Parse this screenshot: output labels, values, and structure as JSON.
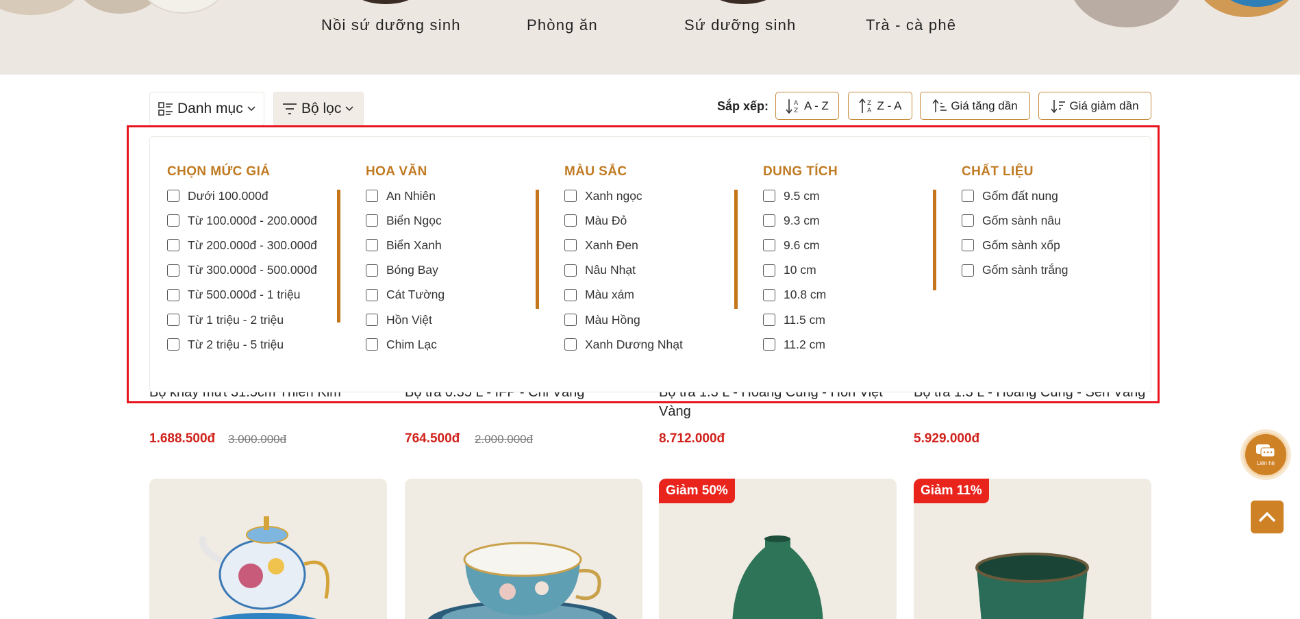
{
  "hero": {
    "categories": [
      "Nồi sứ dưỡng sinh",
      "Phòng ăn",
      "Sứ dưỡng sinh",
      "Trà - cà phê"
    ]
  },
  "toolbar": {
    "category_label": "Danh mục",
    "filter_label": "Bộ lọc",
    "sort_label": "Sắp xếp:",
    "sort_options": [
      "A - Z",
      "Z - A",
      "Giá tăng dần",
      "Giá giảm dần"
    ]
  },
  "filters": [
    {
      "title": "CHỌN MỨC GIÁ",
      "options": [
        "Dưới 100.000đ",
        "Từ 100.000đ - 200.000đ",
        "Từ 200.000đ - 300.000đ",
        "Từ 300.000đ - 500.000đ",
        "Từ 500.000đ - 1 triệu",
        "Từ 1 triệu - 2 triệu",
        "Từ 2 triệu - 5 triệu"
      ]
    },
    {
      "title": "HOA VĂN",
      "options": [
        "An Nhiên",
        "Biển Ngọc",
        "Biển Xanh",
        "Bóng Bay",
        "Cát Tường",
        "Hồn Việt",
        "Chim Lạc"
      ]
    },
    {
      "title": "MÀU SẮC",
      "options": [
        "Xanh ngọc",
        "Màu Đỏ",
        "Xanh Đen",
        "Nâu Nhạt",
        "Màu xám",
        "Màu Hồng",
        "Xanh Dương Nhạt"
      ]
    },
    {
      "title": "DUNG TÍCH",
      "options": [
        "9.5 cm",
        "9.3 cm",
        "9.6 cm",
        "10 cm",
        "10.8 cm",
        "11.5 cm",
        "11.2 cm"
      ]
    },
    {
      "title": "CHẤT LIỆU",
      "options": [
        "Gốm đất nung",
        "Gốm sành nâu",
        "Gốm sành xốp",
        "Gốm sành trắng"
      ]
    }
  ],
  "products_row1": [
    {
      "name": "Bộ khay mứt 31.5cm Thiên Kim",
      "price": "1.688.500đ",
      "old_price": "3.000.000đ"
    },
    {
      "name": "Bộ trà 0.35 L - IFP - Chỉ Vàng",
      "price": "764.500đ",
      "old_price": "2.000.000đ"
    },
    {
      "name": "Bộ trà 1.3 L - Hoàng Cung - Hồn Việt Vàng",
      "price": "8.712.000đ",
      "old_price": ""
    },
    {
      "name": "Bộ trà 1.3 L - Hoàng Cung - Sen Vàng",
      "price": "5.929.000đ",
      "old_price": ""
    }
  ],
  "products_row2": [
    {
      "badge": ""
    },
    {
      "badge": ""
    },
    {
      "badge": "Giảm 50%"
    },
    {
      "badge": "Giảm 11%"
    }
  ],
  "floating": {
    "contact_label": "Liên hệ"
  },
  "colors": {
    "accent": "#c5761b",
    "sale_red": "#d0211b",
    "highlight_border": "#e8141e"
  }
}
